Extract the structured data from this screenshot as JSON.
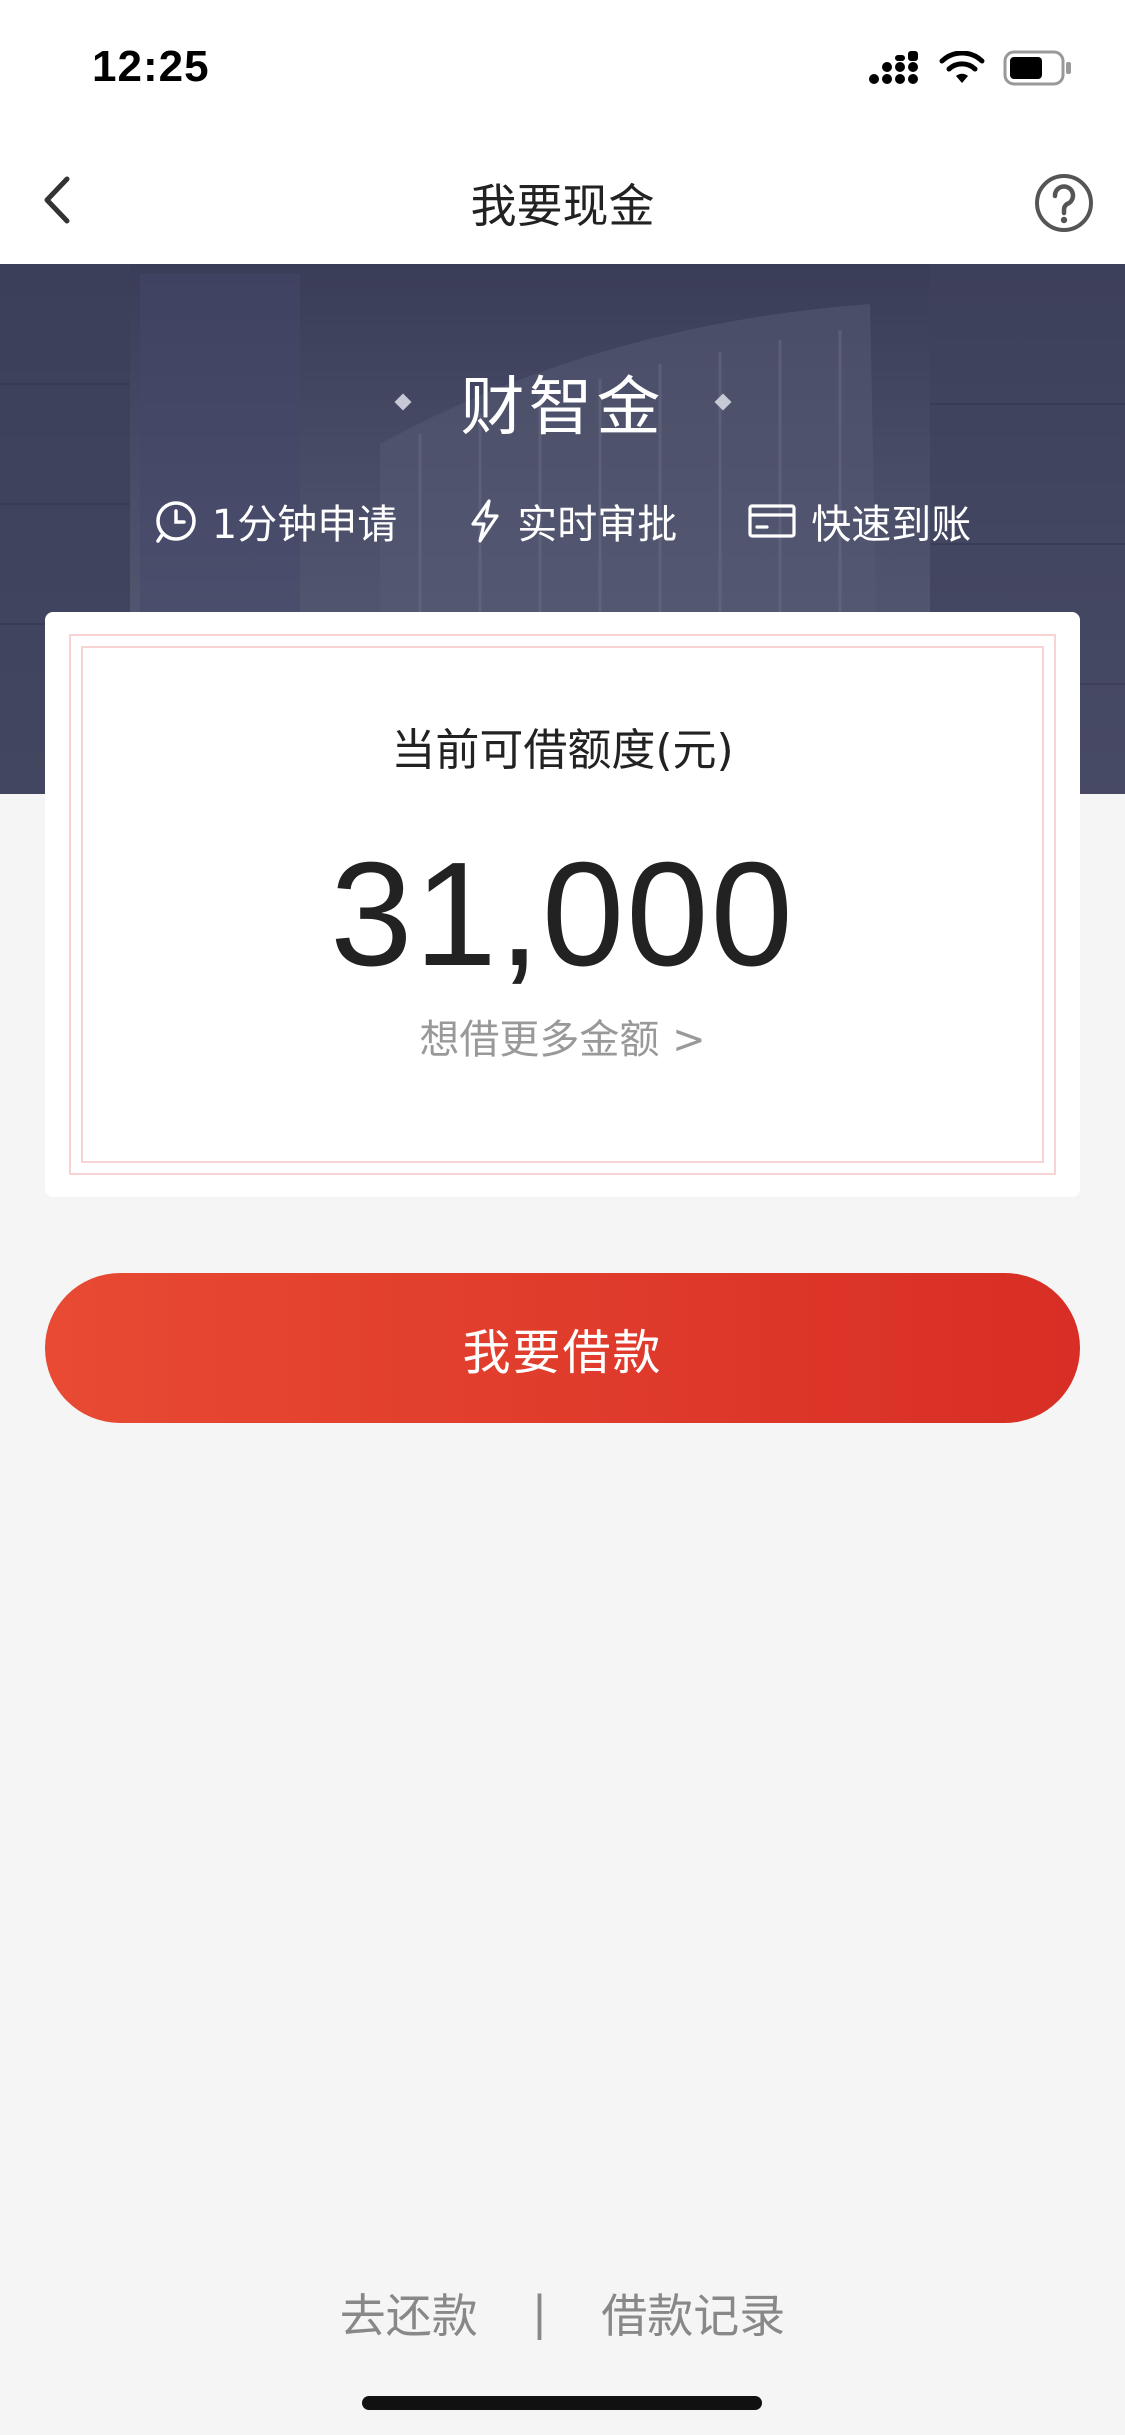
{
  "status_bar": {
    "time": "12:25",
    "icons": [
      "cellular-signal-icon",
      "wifi-icon",
      "battery-icon"
    ]
  },
  "nav": {
    "title": "我要现金",
    "back_icon": "chevron-left-icon",
    "help_icon": "question-circle-icon"
  },
  "banner": {
    "title": "财智金",
    "features": [
      {
        "icon": "clock-icon",
        "label": "1分钟申请"
      },
      {
        "icon": "lightning-icon",
        "label": "实时审批"
      },
      {
        "icon": "card-icon",
        "label": "快速到账"
      }
    ]
  },
  "credit": {
    "label": "当前可借额度(元)",
    "amount": "31,000",
    "more_link": "想借更多金额 >"
  },
  "actions": {
    "borrow_label": "我要借款"
  },
  "footer": {
    "repay_label": "去还款",
    "separator": "|",
    "records_label": "借款记录"
  },
  "colors": {
    "accent": "#e03a2c",
    "banner_bg": "#464a63",
    "frame": "#f7d3d3",
    "muted_text": "#999999"
  }
}
